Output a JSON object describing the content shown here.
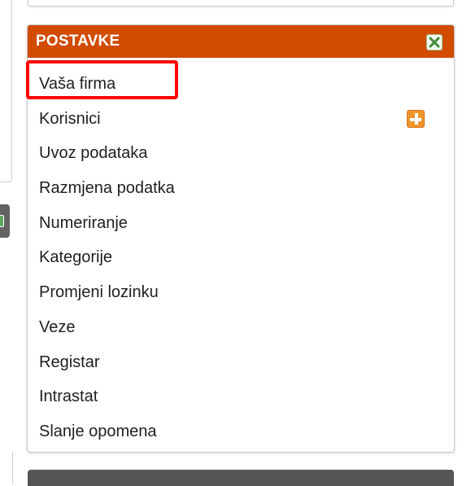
{
  "panel": {
    "title": "POSTAVKE",
    "header_color": "#d14b00",
    "close_icon": "close-x-icon",
    "items": [
      {
        "label": "Vaša firma",
        "highlighted": true
      },
      {
        "label": "Korisnici",
        "action_icon": "add-plus-icon"
      },
      {
        "label": "Uvoz podataka"
      },
      {
        "label": "Razmjena podatka"
      },
      {
        "label": "Numeriranje"
      },
      {
        "label": "Kategorije"
      },
      {
        "label": "Promjeni lozinku"
      },
      {
        "label": "Veze"
      },
      {
        "label": "Registar"
      },
      {
        "label": "Intrastat"
      },
      {
        "label": "Slanje opomena"
      }
    ]
  },
  "highlight_color": "#ff0000"
}
